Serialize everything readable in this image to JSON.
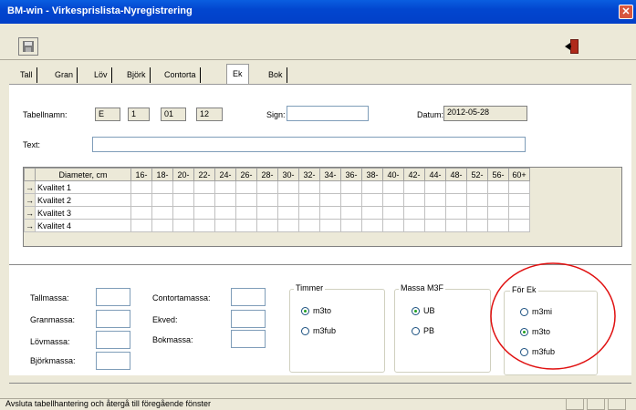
{
  "window": {
    "title": "BM-win - Virkesprislista-Nyregistrering"
  },
  "icons": {
    "close": "close-icon",
    "save": "save-icon",
    "exit": "exit-door-icon",
    "arrow": "→"
  },
  "tabs": [
    "Tall",
    "Gran",
    "Löv",
    "Björk",
    "Contorta",
    "Ek",
    "Bok"
  ],
  "active_tab": "Ek",
  "form": {
    "tabellnamn_label": "Tabellnamn:",
    "tn1": "E",
    "tn2": "1",
    "tn3": "01",
    "tn4": "12",
    "sign_label": "Sign:",
    "sign_value": "",
    "datum_label": "Datum:",
    "datum_value": "2012-05-28",
    "text_label": "Text:",
    "text_value": ""
  },
  "grid": {
    "header": "Diameter, cm",
    "columns": [
      "16-",
      "18-",
      "20-",
      "22-",
      "24-",
      "26-",
      "28-",
      "30-",
      "32-",
      "34-",
      "36-",
      "38-",
      "40-",
      "42-",
      "44-",
      "48-",
      "52-",
      "56-",
      "60+"
    ],
    "rows": [
      "Kvalitet 1",
      "Kvalitet 2",
      "Kvalitet 3",
      "Kvalitet 4"
    ]
  },
  "massa": {
    "tallmassa": "Tallmassa:",
    "granmassa": "Granmassa:",
    "lovmassa": "Lövmassa:",
    "bjorkmassa": "Björkmassa:",
    "contortamassa": "Contortamassa:",
    "ekved": "Ekved:",
    "bokmassa": "Bokmassa:"
  },
  "timmer": {
    "title": "Timmer",
    "opt1": "m3to",
    "opt2": "m3fub",
    "selected": "m3to"
  },
  "massam3f": {
    "title": "Massa M3F",
    "opt1": "UB",
    "opt2": "PB",
    "selected": "UB"
  },
  "forek": {
    "title": "För Ek",
    "opt1": "m3mi",
    "opt2": "m3to",
    "opt3": "m3fub",
    "selected": "m3to"
  },
  "annotation_color": "#e01010",
  "status": {
    "text": "Avsluta tabellhantering och återgå till föregående fönster"
  }
}
